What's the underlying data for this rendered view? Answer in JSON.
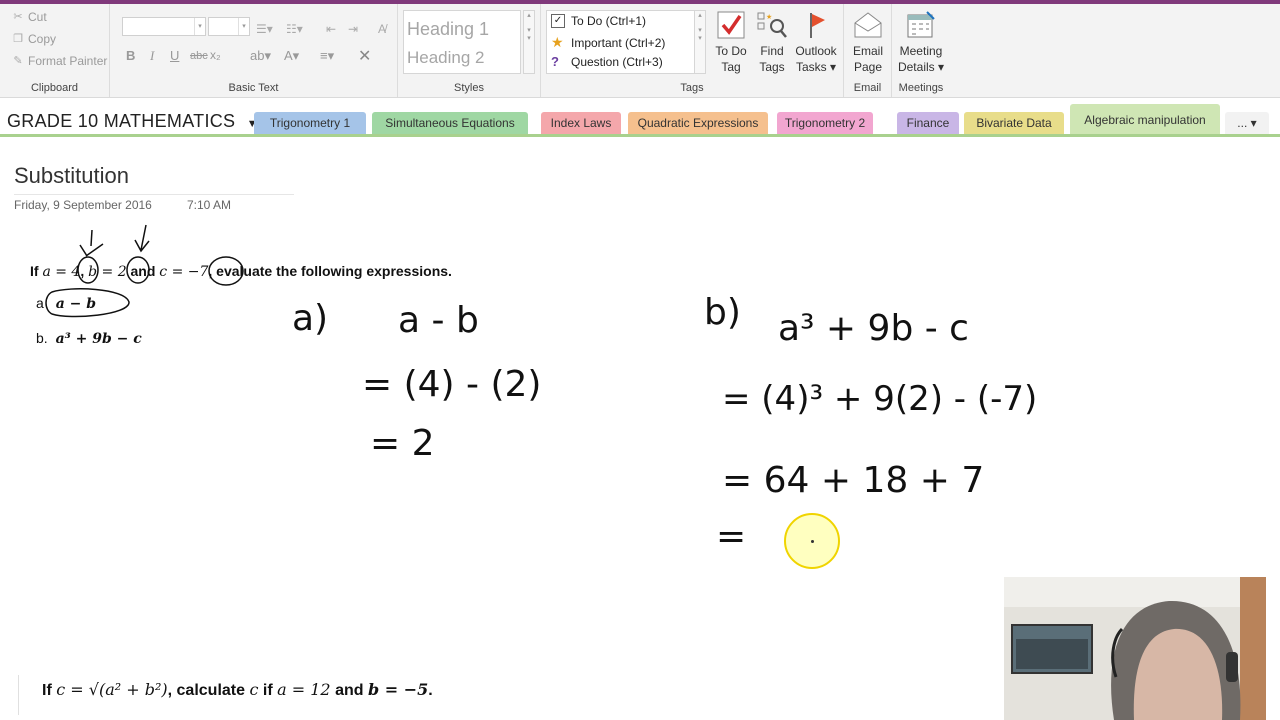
{
  "clipboard": {
    "cut_label": "Cut",
    "copy_label": "Copy",
    "format_painter_label": "Format Painter",
    "group_label": "Clipboard"
  },
  "basic_text": {
    "group_label": "Basic Text",
    "bold": "B",
    "italic": "I",
    "underline": "U",
    "strike": "abc",
    "subscript": "x₂"
  },
  "styles": {
    "group_label": "Styles",
    "items": [
      "Heading 1",
      "Heading 2"
    ]
  },
  "tags": {
    "group_label": "Tags",
    "items": [
      {
        "label": "To Do (Ctrl+1)",
        "icon": "checkbox-icon"
      },
      {
        "label": "Important (Ctrl+2)",
        "icon": "star-icon"
      },
      {
        "label": "Question (Ctrl+3)",
        "icon": "question-icon"
      }
    ],
    "todo_tag_line1": "To Do",
    "todo_tag_line2": "Tag",
    "find_tags_line1": "Find",
    "find_tags_line2": "Tags",
    "outlook_tasks_line1": "Outlook",
    "outlook_tasks_line2": "Tasks ▾"
  },
  "email": {
    "group_label": "Email",
    "line1": "Email",
    "line2": "Page"
  },
  "meetings": {
    "group_label": "Meetings",
    "line1": "Meeting",
    "line2": "Details ▾"
  },
  "notebook": {
    "title": "GRADE 10 MATHEMATICS",
    "more_label": "...",
    "sections": [
      {
        "label": "Trigonometry 1",
        "color": "#a5c4e8"
      },
      {
        "label": "Simultaneous Equations",
        "color": "#9fd7a3"
      },
      {
        "label": "Index Laws",
        "color": "#f4a7ab"
      },
      {
        "label": "Quadratic Expressions",
        "color": "#f5c08e"
      },
      {
        "label": "Trigonometry 2",
        "color": "#f2a6d0"
      },
      {
        "label": "Finance",
        "color": "#c9b6e6"
      },
      {
        "label": "Bivariate Data",
        "color": "#e8dd8a"
      },
      {
        "label": "Algebraic manipulation",
        "color": "#cfe6b4"
      }
    ],
    "active_section": "Algebraic manipulation"
  },
  "page": {
    "title": "Substitution",
    "date": "Friday, 9 September 2016",
    "time": "7:10 AM"
  },
  "content": {
    "q1_if": "If",
    "q1_a": "a = 4",
    "q1_b": "b = 2",
    "q1_and": "and",
    "q1_c": "c = −7",
    "q1_tail": ", evaluate the following expressions.",
    "qa_label": "a",
    "qa_expr": "a − b",
    "qb_label": "b.",
    "qb_expr": "a³ + 9b − c",
    "q2_if": "If",
    "q2_c": "c = √(a² + b²)",
    "q2_mid": ", calculate",
    "q2_var": "c",
    "q2_if2": "if",
    "q2_a": "a = 12",
    "q2_and": "and",
    "q2_b": "b = −5",
    "q2_end": "."
  },
  "handwriting": {
    "a_label": "a)",
    "a_expr": "a - b",
    "a_line2": "= (4) - (2)",
    "a_line3": "= 2",
    "b_label": "b)",
    "b_expr": "a³ + 9b - c",
    "b_line2": "= (4)³ + 9(2) - (-7)",
    "b_line3": "= 64 + 18 + 7",
    "b_line4": "="
  },
  "colors": {
    "accent": "#80397b",
    "active_tab": "#cfe6b4",
    "ink": "#111111",
    "cursor_highlight": "#f0d400"
  }
}
